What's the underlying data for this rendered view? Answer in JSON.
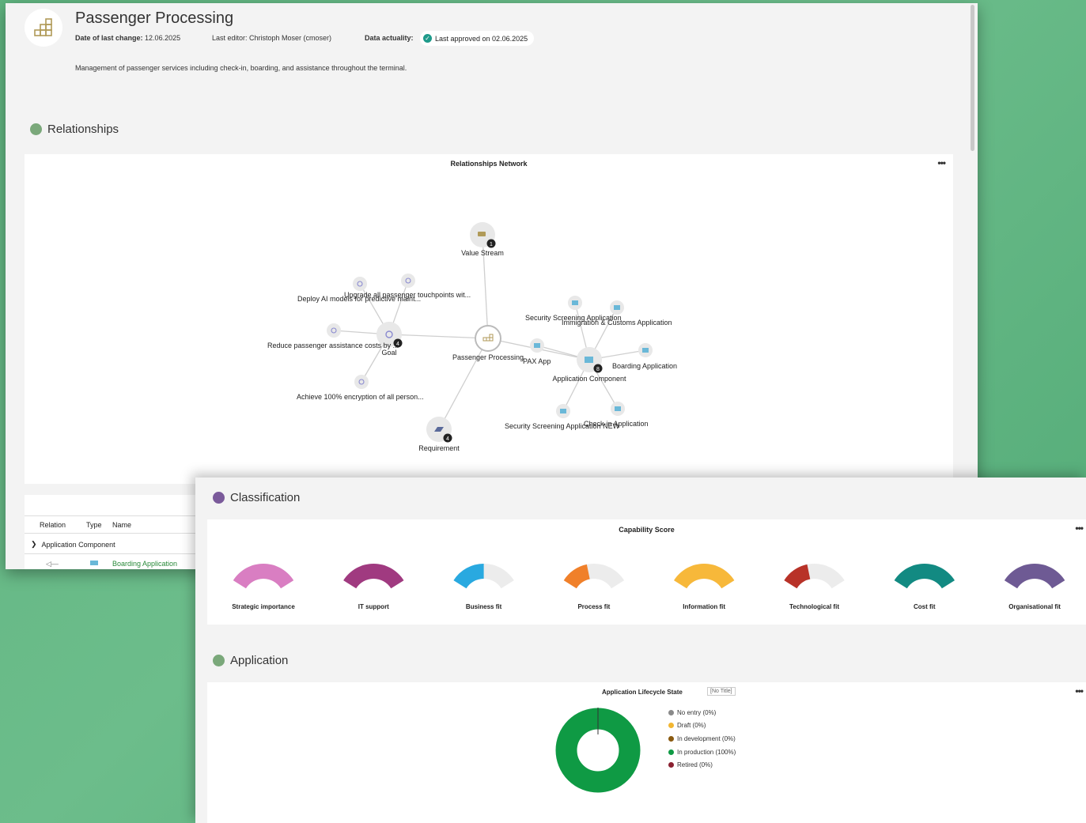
{
  "header": {
    "title": "Passenger Processing",
    "date_label": "Date of last change:",
    "date_value": "12.06.2025",
    "editor": "Last editor: Christoph Moser (cmoser)",
    "actuality_label": "Data actuality:",
    "actuality_value": "Last approved on 02.06.2025",
    "description": "Management of passenger services including check-in, boarding, and assistance throughout the terminal."
  },
  "relationships": {
    "section_title": "Relationships",
    "dot_color": "#7aa87a",
    "network_title": "Relationships Network",
    "more": "•••",
    "nodes": {
      "center": "Passenger Processing",
      "value_stream": "Value Stream",
      "value_stream_count": "1",
      "goal": "Goal",
      "goal_count": "4",
      "app_component": "Application Component",
      "app_component_count": "8",
      "requirement": "Requirement",
      "requirement_count": "4"
    },
    "leaf_labels": {
      "deploy_ai": "Deploy AI models for predictive maint...",
      "upgrade": "Upgrade all passenger touchpoints wit...",
      "reduce": "Reduce passenger assistance costs by ...",
      "achieve": "Achieve 100% encryption of all person...",
      "security_screening": "Security Screening Application",
      "immigration": "Immigration & Customs Application",
      "pax_app": "PAX App",
      "boarding": "Boarding Application",
      "security_screening_new": "Security Screening Application NEW",
      "checkin": "Check-in Application"
    }
  },
  "table": {
    "columns": [
      "Relation",
      "Type",
      "Name"
    ],
    "group": "Application Component",
    "row_name": "Boarding Application",
    "row_arrow": "◁—"
  },
  "classification": {
    "section_title": "Classification",
    "dot_color": "#7a5a9a",
    "panel_title": "Capability Score",
    "more": "•••",
    "gauges": [
      {
        "label": "Strategic importance",
        "value": 1.0,
        "color": "#d97ec2"
      },
      {
        "label": "IT support",
        "value": 1.0,
        "color": "#a03a80"
      },
      {
        "label": "Business fit",
        "value": 0.5,
        "color": "#29a9e0"
      },
      {
        "label": "Process fit",
        "value": 0.4,
        "color": "#f0802a"
      },
      {
        "label": "Information fit",
        "value": 1.0,
        "color": "#f7b83a"
      },
      {
        "label": "Technological fit",
        "value": 0.4,
        "color": "#b83228"
      },
      {
        "label": "Cost fit",
        "value": 1.0,
        "color": "#128a82"
      },
      {
        "label": "Organisational fit",
        "value": 1.0,
        "color": "#6e5a94"
      }
    ]
  },
  "application": {
    "section_title": "Application",
    "dot_color": "#7aa87a",
    "panel_title": "Application Lifecycle State",
    "no_title": "[No Title]",
    "more": "•••",
    "legend": [
      {
        "label": "No entry (0%)",
        "color": "#8a8a8a"
      },
      {
        "label": "Draft (0%)",
        "color": "#f2b632"
      },
      {
        "label": "In development (0%)",
        "color": "#8a5a10"
      },
      {
        "label": "In production (100%)",
        "color": "#0f9a44"
      },
      {
        "label": "Retired (0%)",
        "color": "#8a2030"
      }
    ]
  }
}
